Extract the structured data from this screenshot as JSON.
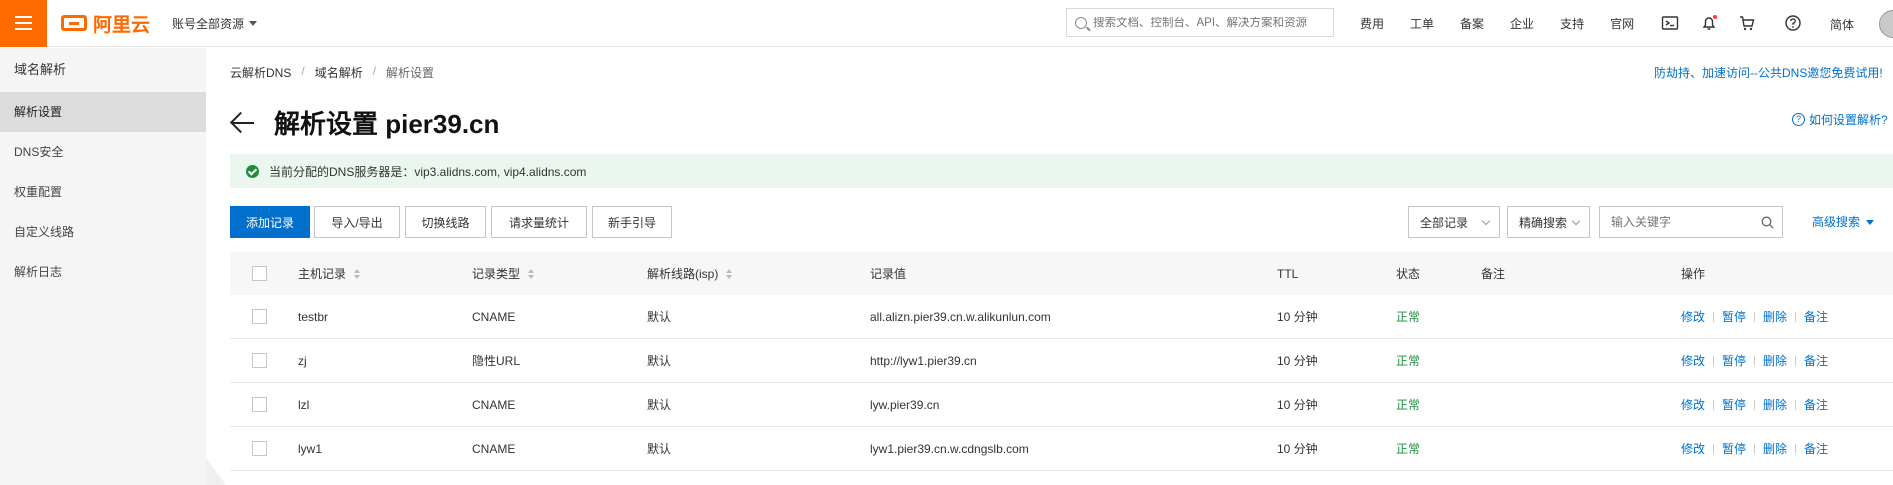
{
  "header": {
    "brand": "阿里云",
    "account_scope": "账号全部资源",
    "search_placeholder": "搜索文档、控制台、API、解决方案和资源",
    "links": [
      "费用",
      "工单",
      "备案",
      "企业",
      "支持",
      "官网"
    ],
    "language": "简体",
    "icons": [
      "terminal-icon",
      "bell-icon",
      "cart-icon",
      "help-icon"
    ],
    "accent_color": "#ff6a00"
  },
  "sidebar": {
    "title": "域名解析",
    "items": [
      {
        "label": "解析设置",
        "active": true
      },
      {
        "label": "DNS安全",
        "active": false
      },
      {
        "label": "权重配置",
        "active": false
      },
      {
        "label": "自定义线路",
        "active": false
      },
      {
        "label": "解析日志",
        "active": false
      }
    ]
  },
  "breadcrumb": [
    "云解析DNS",
    "域名解析",
    "解析设置"
  ],
  "promo_link": "防劫持、加速访问--公共DNS邀您免费试用!",
  "page": {
    "title": "解析设置 pier39.cn",
    "help": "如何设置解析?"
  },
  "notice": "当前分配的DNS服务器是：vip3.alidns.com, vip4.alidns.com",
  "toolbar": {
    "buttons": [
      "添加记录",
      "导入/导出",
      "切换线路",
      "请求量统计",
      "新手引导"
    ],
    "filter_select": "全部记录",
    "search_mode": "精确搜索",
    "keyword_placeholder": "输入关键字",
    "advanced": "高级搜索"
  },
  "table": {
    "columns": [
      "主机记录",
      "记录类型",
      "解析线路(isp)",
      "记录值",
      "TTL",
      "状态",
      "备注",
      "操作"
    ],
    "rows": [
      {
        "host": "testbr",
        "type": "CNAME",
        "line": "默认",
        "value": "all.alizn.pier39.cn.w.alikunlun.com",
        "ttl": "10 分钟",
        "status": "正常",
        "note": ""
      },
      {
        "host": "zj",
        "type": "隐性URL",
        "line": "默认",
        "value": "http://lyw1.pier39.cn",
        "ttl": "10 分钟",
        "status": "正常",
        "note": ""
      },
      {
        "host": "lzl",
        "type": "CNAME",
        "line": "默认",
        "value": "lyw.pier39.cn",
        "ttl": "10 分钟",
        "status": "正常",
        "note": ""
      },
      {
        "host": "lyw1",
        "type": "CNAME",
        "line": "默认",
        "value": "lyw1.pier39.cn.w.cdngslb.com",
        "ttl": "10 分钟",
        "status": "正常",
        "note": ""
      }
    ],
    "actions": [
      "修改",
      "暂停",
      "删除",
      "备注"
    ],
    "status_color": "#1e8e3e",
    "link_color": "#0070cc"
  }
}
